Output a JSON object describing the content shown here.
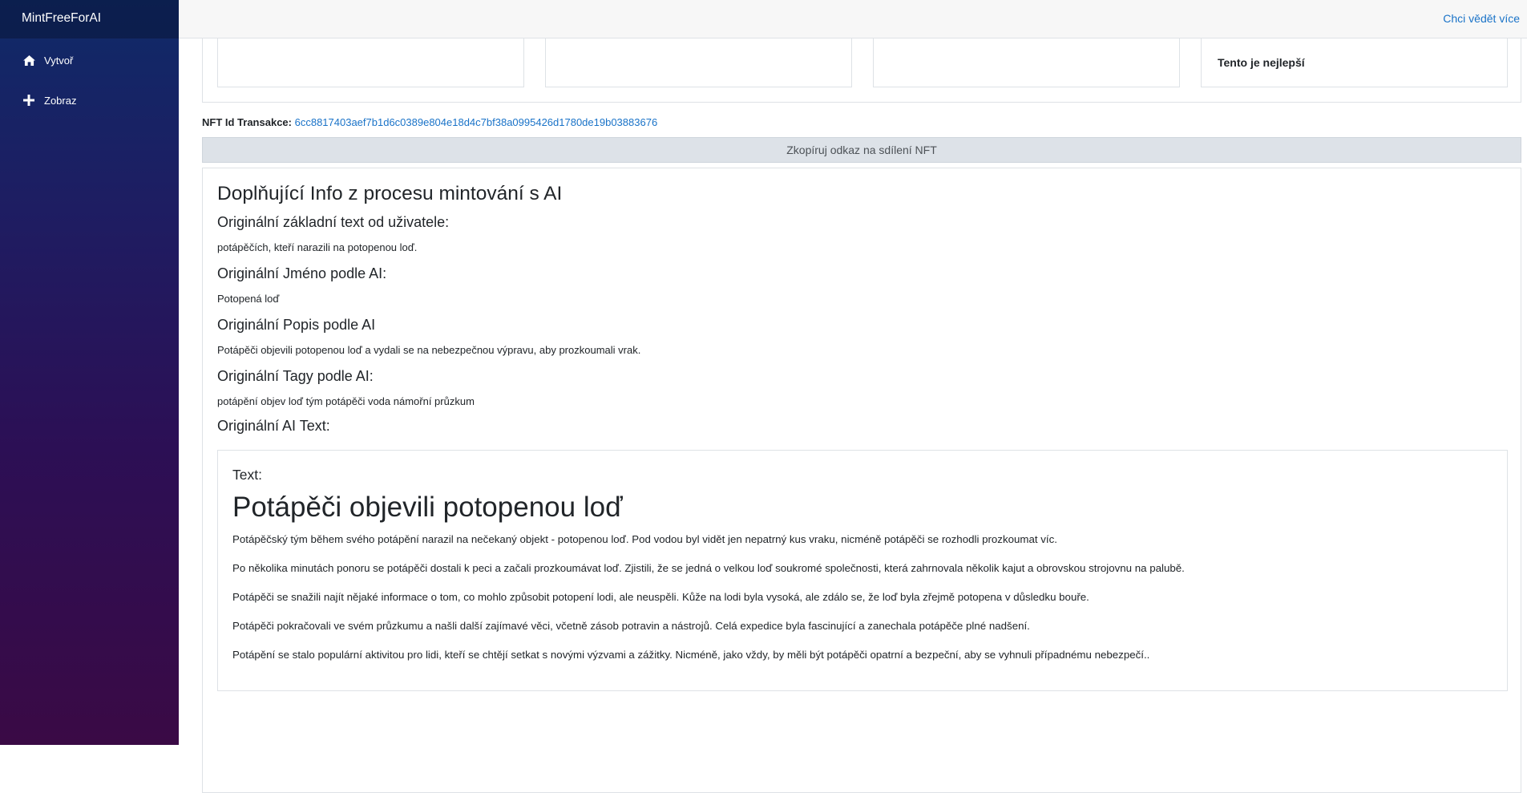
{
  "app": {
    "brand": "MintFreeForAI"
  },
  "sidebar": {
    "items": [
      {
        "label": "Vytvoř",
        "icon": "home-icon"
      },
      {
        "label": "Zobraz",
        "icon": "plus-icon"
      }
    ]
  },
  "topbar": {
    "learn_more": "Chci vědět více"
  },
  "cards": {
    "best_label": "Tento je nejlepší"
  },
  "transaction": {
    "label": "NFT Id Transakce:",
    "id": "6cc8817403aef7b1d6c0389e804e18d4c7bf38a0995426d1780de19b03883676"
  },
  "share": {
    "copy_label": "Zkopíruj odkaz na sdílení NFT"
  },
  "info": {
    "title": "Doplňující Info z procesu mintování s AI",
    "original_text_heading": "Originální základní text od uživatele:",
    "original_text": "potápěčích, kteří narazili na potopenou loď.",
    "original_name_heading": "Originální Jméno podle AI:",
    "original_name": "Potopená loď",
    "original_desc_heading": "Originální Popis podle AI",
    "original_desc": "Potápěči objevili potopenou loď a vydali se na nebezpečnou výpravu, aby prozkoumali vrak.",
    "original_tags_heading": "Originální Tagy podle AI:",
    "original_tags": "potápění objev loď tým potápěči voda námořní průzkum",
    "original_ai_heading": "Originální AI Text:"
  },
  "ai_text": {
    "label": "Text:",
    "headline": "Potápěči objevili potopenou loď",
    "paragraphs": [
      "Potápěčský tým během svého potápění narazil na nečekaný objekt - potopenou loď. Pod vodou byl vidět jen nepatrný kus vraku, nicméně potápěči se rozhodli prozkoumat víc.",
      "Po několika minutách ponoru se potápěči dostali k peci a začali prozkoumávat loď. Zjistili, že se jedná o velkou loď soukromé společnosti, která zahrnovala několik kajut a obrovskou strojovnu na palubě.",
      "Potápěči se snažili najít nějaké informace o tom, co mohlo způsobit potopení lodi, ale neuspěli. Kůže na lodi byla vysoká, ale zdálo se, že loď byla zřejmě potopena v důsledku bouře.",
      "Potápěči pokračovali ve svém průzkumu a našli další zajímavé věci, včetně zásob potravin a nástrojů. Celá expedice byla fascinující a zanechala potápěče plné nadšení.",
      "Potápění se stalo populární aktivitou pro lidi, kteří se chtějí setkat s novými výzvami a zážitky. Nicméně, jako vždy, by měli být potápěči opatrní a bezpeční, aby se vyhnuli případnému nebezpečí.."
    ]
  }
}
